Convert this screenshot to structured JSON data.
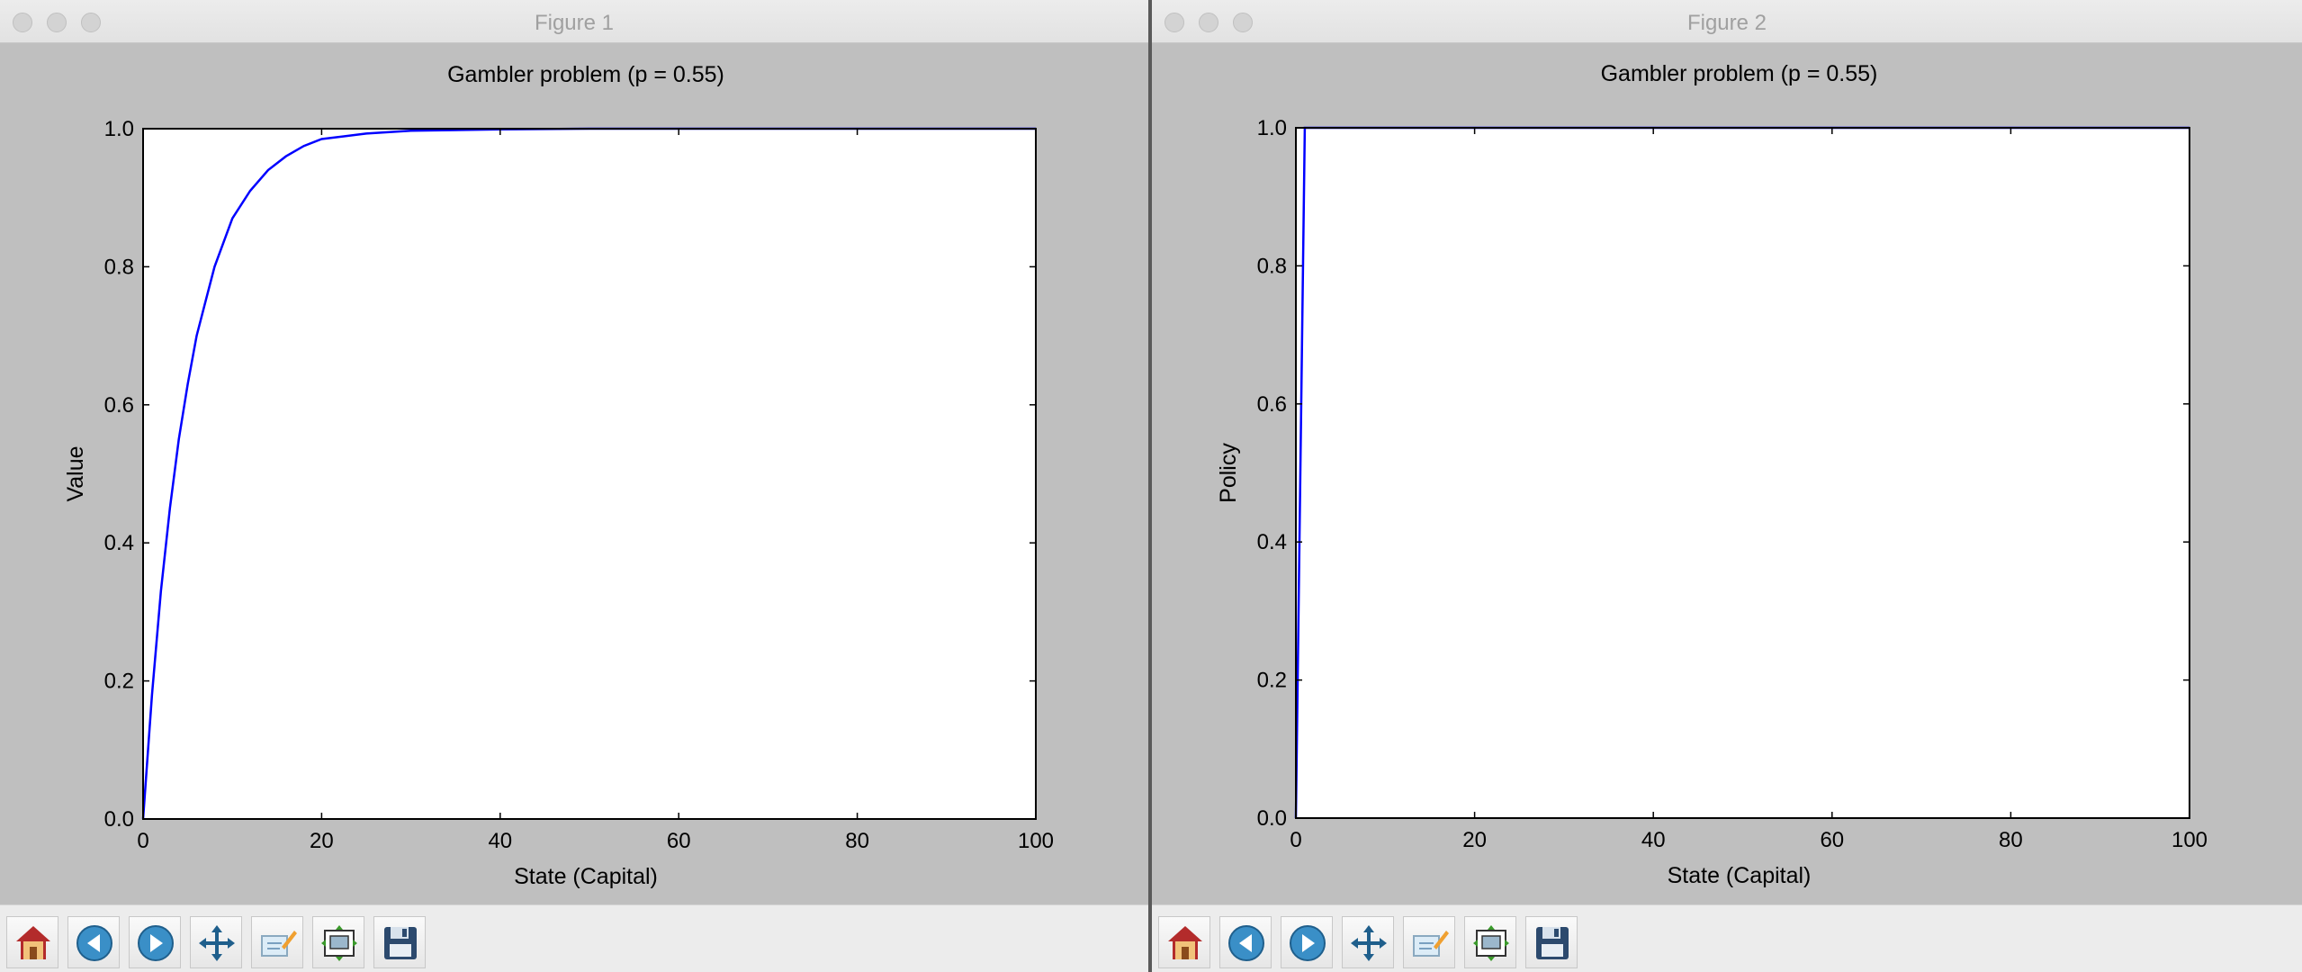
{
  "windows": [
    {
      "title": "Figure 1",
      "chart_data": {
        "type": "line",
        "title": "Gambler problem (p = 0.55)",
        "xlabel": "State (Capital)",
        "ylabel": "Value",
        "xlim": [
          0,
          100
        ],
        "ylim": [
          0,
          1.0
        ],
        "xticks": [
          "0",
          "20",
          "40",
          "60",
          "80",
          "100"
        ],
        "yticks": [
          "0.0",
          "0.2",
          "0.4",
          "0.6",
          "0.8",
          "1.0"
        ],
        "grid": false,
        "series": [
          {
            "color": "#0000ff",
            "x": [
              0,
              1,
              2,
              3,
              4,
              5,
              6,
              7,
              8,
              10,
              12,
              14,
              16,
              18,
              20,
              25,
              30,
              40,
              50,
              60,
              70,
              80,
              90,
              100
            ],
            "values": [
              0.0,
              0.18,
              0.33,
              0.45,
              0.55,
              0.63,
              0.7,
              0.75,
              0.8,
              0.87,
              0.91,
              0.94,
              0.96,
              0.975,
              0.985,
              0.993,
              0.997,
              0.999,
              1.0,
              1.0,
              1.0,
              1.0,
              1.0,
              1.0
            ]
          }
        ]
      }
    },
    {
      "title": "Figure 2",
      "chart_data": {
        "type": "line",
        "title": "Gambler problem (p = 0.55)",
        "xlabel": "State (Capital)",
        "ylabel": "Policy",
        "xlim": [
          0,
          100
        ],
        "ylim": [
          0,
          1.0
        ],
        "xticks": [
          "0",
          "20",
          "40",
          "60",
          "80",
          "100"
        ],
        "yticks": [
          "0.0",
          "0.2",
          "0.4",
          "0.6",
          "0.8",
          "1.0"
        ],
        "grid": false,
        "series": [
          {
            "color": "#0000ff",
            "x": [
              0,
              1,
              2,
              10,
              20,
              40,
              60,
              80,
              100
            ],
            "values": [
              0.0,
              1.0,
              1.0,
              1.0,
              1.0,
              1.0,
              1.0,
              1.0,
              1.0
            ]
          }
        ]
      }
    }
  ],
  "toolbar": {
    "buttons": [
      {
        "name": "home-button",
        "icon": "home-icon"
      },
      {
        "name": "back-button",
        "icon": "back-arrow-icon"
      },
      {
        "name": "forward-button",
        "icon": "forward-arrow-icon"
      },
      {
        "name": "pan-button",
        "icon": "move-icon"
      },
      {
        "name": "zoom-button",
        "icon": "zoom-rect-icon"
      },
      {
        "name": "configure-subplots-button",
        "icon": "subplots-icon"
      },
      {
        "name": "save-button",
        "icon": "floppy-disk-icon"
      }
    ]
  }
}
